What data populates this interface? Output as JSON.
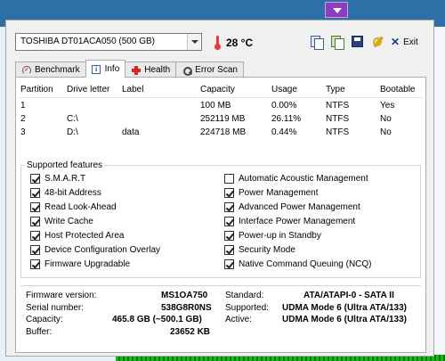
{
  "drive_select": {
    "value": "TOSHIBA DT01ACA050 (500 GB)"
  },
  "temperature": "28 °C",
  "toolbar": {
    "copy_icon": "copy-icon",
    "copy_screenshot_icon": "copy-screenshot-icon",
    "save_icon": "save-icon",
    "options_icon": "options-icon",
    "exit_label": "Exit"
  },
  "tabs": [
    {
      "label": "Benchmark",
      "icon": "benchmark-icon"
    },
    {
      "label": "Info",
      "icon": "info-icon",
      "active": true
    },
    {
      "label": "Health",
      "icon": "health-icon"
    },
    {
      "label": "Error Scan",
      "icon": "error-scan-icon"
    }
  ],
  "partitions": {
    "columns": [
      "Partition",
      "Drive letter",
      "Label",
      "Capacity",
      "Usage",
      "Type",
      "Bootable"
    ],
    "rows": [
      [
        "1",
        "",
        "",
        "100 MB",
        "0.00%",
        "NTFS",
        "Yes"
      ],
      [
        "2",
        "C:\\",
        "",
        "252119 MB",
        "26.11%",
        "NTFS",
        "No"
      ],
      [
        "3",
        "D:\\",
        "data",
        "224718 MB",
        "0.44%",
        "NTFS",
        "No"
      ]
    ]
  },
  "features": {
    "title": "Supported features",
    "left": [
      {
        "label": "S.M.A.R.T",
        "checked": true
      },
      {
        "label": "48-bit Address",
        "checked": true
      },
      {
        "label": "Read Look-Ahead",
        "checked": true
      },
      {
        "label": "Write Cache",
        "checked": true
      },
      {
        "label": "Host Protected Area",
        "checked": true
      },
      {
        "label": "Device Configuration Overlay",
        "checked": true
      },
      {
        "label": "Firmware Upgradable",
        "checked": true
      }
    ],
    "right": [
      {
        "label": "Automatic Acoustic Management",
        "checked": false
      },
      {
        "label": "Power Management",
        "checked": true
      },
      {
        "label": "Advanced Power Management",
        "checked": true
      },
      {
        "label": "Interface Power Management",
        "checked": true
      },
      {
        "label": "Power-up in Standby",
        "checked": true
      },
      {
        "label": "Security Mode",
        "checked": true
      },
      {
        "label": "Native Command Queuing (NCQ)",
        "checked": true
      }
    ]
  },
  "details": {
    "firmware_label": "Firmware version:",
    "firmware": "MS1OA750",
    "serial_label": "Serial number:",
    "serial": "538G8R0NS",
    "capacity_label": "Capacity:",
    "capacity": "465.8 GB (~500.1 GB)",
    "buffer_label": "Buffer:",
    "buffer": "23652 KB",
    "standard_label": "Standard:",
    "standard": "ATA/ATAPI-0 - SATA II",
    "supported_label": "Supported:",
    "supported": "UDMA Mode 6 (Ultra ATA/133)",
    "active_label": "Active:",
    "active": "UDMA Mode 6 (Ultra ATA/133)"
  }
}
